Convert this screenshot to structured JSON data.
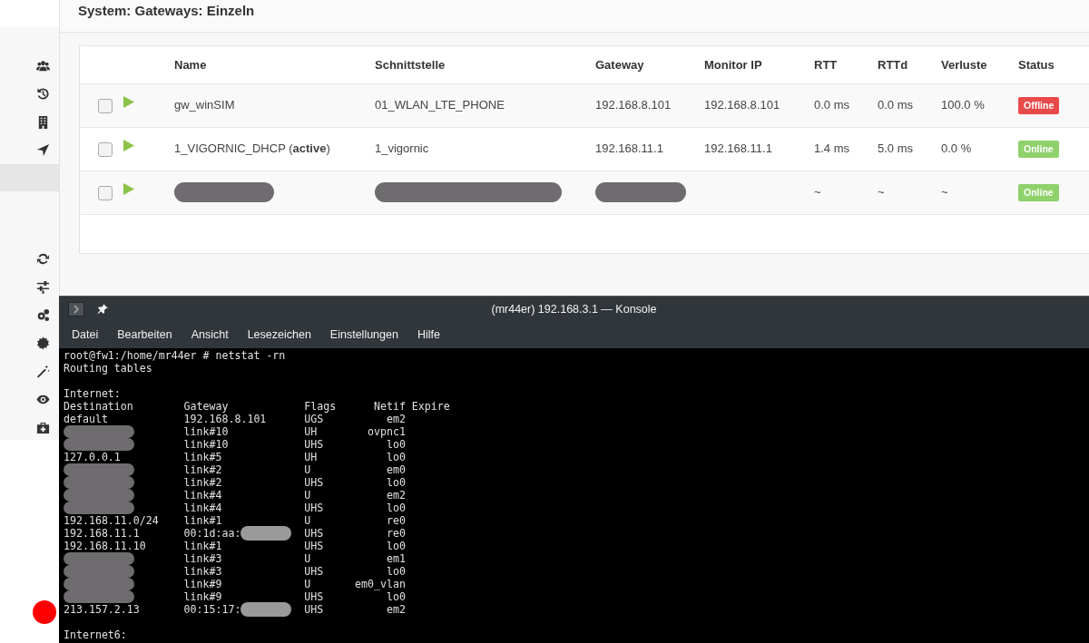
{
  "sidebar": {
    "items": [
      {
        "selected": false
      },
      {
        "selected": false
      },
      {
        "selected": false
      },
      {
        "selected": false
      },
      {
        "selected": true
      },
      {
        "selected": false
      },
      {
        "selected": false
      },
      {
        "selected": false
      },
      {
        "selected": false
      },
      {
        "selected": false
      },
      {
        "selected": false
      },
      {
        "selected": false
      }
    ]
  },
  "page_title": "System: Gateways: Einzeln",
  "table": {
    "columns": [
      "Name",
      "Schnittstelle",
      "Gateway",
      "Monitor IP",
      "RTT",
      "RTTd",
      "Verluste",
      "Status"
    ],
    "rows": [
      {
        "checked": false,
        "name": "gw_winSIM",
        "interface": "01_WLAN_LTE_PHONE",
        "gateway": "192.168.8.101",
        "monitor_ip": "192.168.8.101",
        "rtt": "0.0 ms",
        "rttd": "0.0 ms",
        "loss": "100.0 %",
        "status": "Offline",
        "online": false
      },
      {
        "checked": false,
        "name": "1_VIGORNIC_DHCP (**active**)",
        "interface": "1_vigornic",
        "gateway": "192.168.11.1",
        "monitor_ip": "192.168.11.1",
        "rtt": "1.4 ms",
        "rttd": "5.0 ms",
        "loss": "0.0 %",
        "status": "Online",
        "online": true
      },
      {
        "checked": false,
        "redacted": true,
        "rtt": "~",
        "rttd": "~",
        "loss": "~",
        "status": "Online",
        "online": true
      }
    ]
  },
  "konsole": {
    "title": "(mr44er) 192.168.3.1 — Konsole",
    "menu": [
      "Datei",
      "Bearbeiten",
      "Ansicht",
      "Lesezeichen",
      "Einstellungen",
      "Hilfe"
    ],
    "command": "root@fw1:/home/mr44er # netstat -rn",
    "heading": "Routing tables",
    "section": "Internet:",
    "header": {
      "destination": "Destination",
      "gateway": "Gateway",
      "flags": "Flags",
      "netif": "Netif",
      "expire": "Expire"
    },
    "routes": [
      {
        "destination": "default",
        "gateway": "192.168.8.101",
        "flags": "UGS",
        "netif": "em2"
      },
      {
        "destination_redacted": true,
        "gateway": "link#10",
        "flags": "UH",
        "netif": "ovpnc1"
      },
      {
        "destination_redacted": true,
        "gateway": "link#10",
        "flags": "UHS",
        "netif": "lo0"
      },
      {
        "destination": "127.0.0.1",
        "gateway": "link#5",
        "flags": "UH",
        "netif": "lo0"
      },
      {
        "destination_redacted": true,
        "gateway": "link#2",
        "flags": "U",
        "netif": "em0"
      },
      {
        "destination_redacted": true,
        "gateway": "link#2",
        "flags": "UHS",
        "netif": "lo0"
      },
      {
        "destination_redacted": true,
        "gateway": "link#4",
        "flags": "U",
        "netif": "em2"
      },
      {
        "destination_redacted": true,
        "gateway": "link#4",
        "flags": "UHS",
        "netif": "lo0"
      },
      {
        "destination": "192.168.11.0/24",
        "gateway": "link#1",
        "flags": "U",
        "netif": "re0"
      },
      {
        "destination": "192.168.11.1",
        "gateway": "00:1d:aa:",
        "gateway_redacted": true,
        "flags": "UHS",
        "netif": "re0"
      },
      {
        "destination": "192.168.11.10",
        "gateway": "link#1",
        "flags": "UHS",
        "netif": "lo0"
      },
      {
        "destination_redacted": true,
        "gateway": "link#3",
        "flags": "U",
        "netif": "em1"
      },
      {
        "destination_redacted": true,
        "gateway": "link#3",
        "flags": "UHS",
        "netif": "lo0"
      },
      {
        "destination_redacted": true,
        "gateway": "link#9",
        "flags": "U",
        "netif": "em0_vlan"
      },
      {
        "destination_redacted": true,
        "gateway": "link#9",
        "flags": "UHS",
        "netif": "lo0"
      },
      {
        "destination": "213.157.2.13",
        "gateway": "00:15:17:",
        "gateway_redacted": true,
        "flags": "UHS",
        "netif": "em2"
      }
    ],
    "section_2": "Internet6:"
  }
}
